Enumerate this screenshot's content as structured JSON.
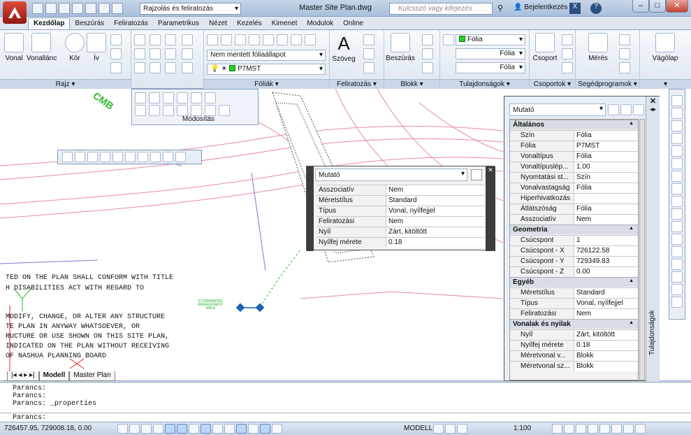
{
  "window": {
    "title": "Master Site Plan.dwg",
    "workspace": "Rajzolás és feliratozás",
    "search_placeholder": "Kulcsszó vagy kifejezés",
    "login": "Bejelentkezés"
  },
  "tabs": [
    "Kezdőlap",
    "Beszúrás",
    "Feliratozás",
    "Parametrikus",
    "Nézet",
    "Kezelés",
    "Kimenet",
    "Modulok",
    "Online"
  ],
  "ribbon": {
    "draw": {
      "label": "Rajz",
      "tools": [
        "Vonal",
        "Vonallánc",
        "Kör",
        "Ív"
      ]
    },
    "modify": {
      "label": "Módosítás"
    },
    "layers": {
      "label": "Fóliák",
      "layer_state": "Nem mentett fóliaállapot",
      "current_layer": "P7MST"
    },
    "annotation": {
      "label": "Feliratozás",
      "text_tool": "Szöveg"
    },
    "block": {
      "label": "Blokk",
      "insert": "Beszúrás"
    },
    "properties": {
      "label": "Tulajdonságok",
      "color": "Fólia",
      "linetype": "Fólia",
      "lineweight": "Fólia"
    },
    "groups": {
      "label": "Csoportok",
      "group": "Csoport"
    },
    "utilities": {
      "label": "Segédprogramok",
      "measure": "Mérés"
    },
    "clipboard": {
      "label": "Vágólap"
    }
  },
  "drawing": {
    "notes": [
      "TED ON THE PLAN SHALL CONFORM WITH TITLE",
      "H DISABILITIES ACT WITH REGARD TO",
      "MODIFY,  CHANGE,  OR ALTER ANY STRUCTURE",
      "TE PLAN IN ANYWAY WHATSOEVER,  OR",
      "RUCTURE OR USE SHOWN ON THIS SITE PLAN,",
      "INDICATED ON THE PLAN WITHOUT RECEIVING",
      "OF NASHUA PLANNING BOARD"
    ],
    "stormwater_label": "STORMWATER MANAGEMENT AREA",
    "layout_tabs": [
      "Modell",
      "Master Plan"
    ]
  },
  "quick_props": {
    "title": "Mutató",
    "rows": [
      [
        "Asszociatív",
        "Nem"
      ],
      [
        "Méretstílus",
        "Standard"
      ],
      [
        "Típus",
        "Vonal, nyílfejjel"
      ],
      [
        "Feliratozási",
        "Nem"
      ],
      [
        "Nyíl",
        "Zárt, kitöltött"
      ],
      [
        "Nyílfej mérete",
        "0.18"
      ]
    ]
  },
  "props_palette": {
    "object": "Mutató",
    "side_label": "Tulajdonságok",
    "sections": [
      {
        "title": "Általános",
        "rows": [
          [
            "Szín",
            "Fólia"
          ],
          [
            "Fólia",
            "P7MST"
          ],
          [
            "Vonaltípus",
            "Fólia"
          ],
          [
            "Vonaltípuslép...",
            "1.00"
          ],
          [
            "Nyomtatási st...",
            "Szín"
          ],
          [
            "Vonalvastagság",
            "Fólia"
          ],
          [
            "Hiperhivatkozás",
            ""
          ],
          [
            "Átlátszóság",
            "Fólia"
          ],
          [
            "Asszociatív",
            "Nem"
          ]
        ]
      },
      {
        "title": "Geometria",
        "rows": [
          [
            "Csúcspont",
            "1"
          ],
          [
            "Csúcspont - X",
            "726122.58"
          ],
          [
            "Csúcspont - Y",
            "729349.83"
          ],
          [
            "Csúcspont - Z",
            "0.00"
          ]
        ]
      },
      {
        "title": "Egyéb",
        "rows": [
          [
            "Méretstílus",
            "Standard"
          ],
          [
            "Típus",
            "Vonal, nyílfejjel"
          ],
          [
            "Feliratozási",
            "Nem"
          ]
        ]
      },
      {
        "title": "Vonalak és nyilak",
        "rows": [
          [
            "Nyíl",
            "Zárt, kitöltött"
          ],
          [
            "Nyílfej mérete",
            "0.18"
          ],
          [
            "Méretvonal v...",
            "Blokk"
          ],
          [
            "Méretvonal sz...",
            "Blokk"
          ]
        ]
      }
    ]
  },
  "command": {
    "history": [
      "Parancs:",
      "Parancs:",
      "Parancs: _properties"
    ],
    "prompt": "Parancs:"
  },
  "status": {
    "coords": "726457.95, 729008.18, 0.00",
    "space": "MODELL",
    "scale": "1:100"
  },
  "colors": {
    "accent": "#1f5fb8",
    "layer_green": "#20d020"
  }
}
